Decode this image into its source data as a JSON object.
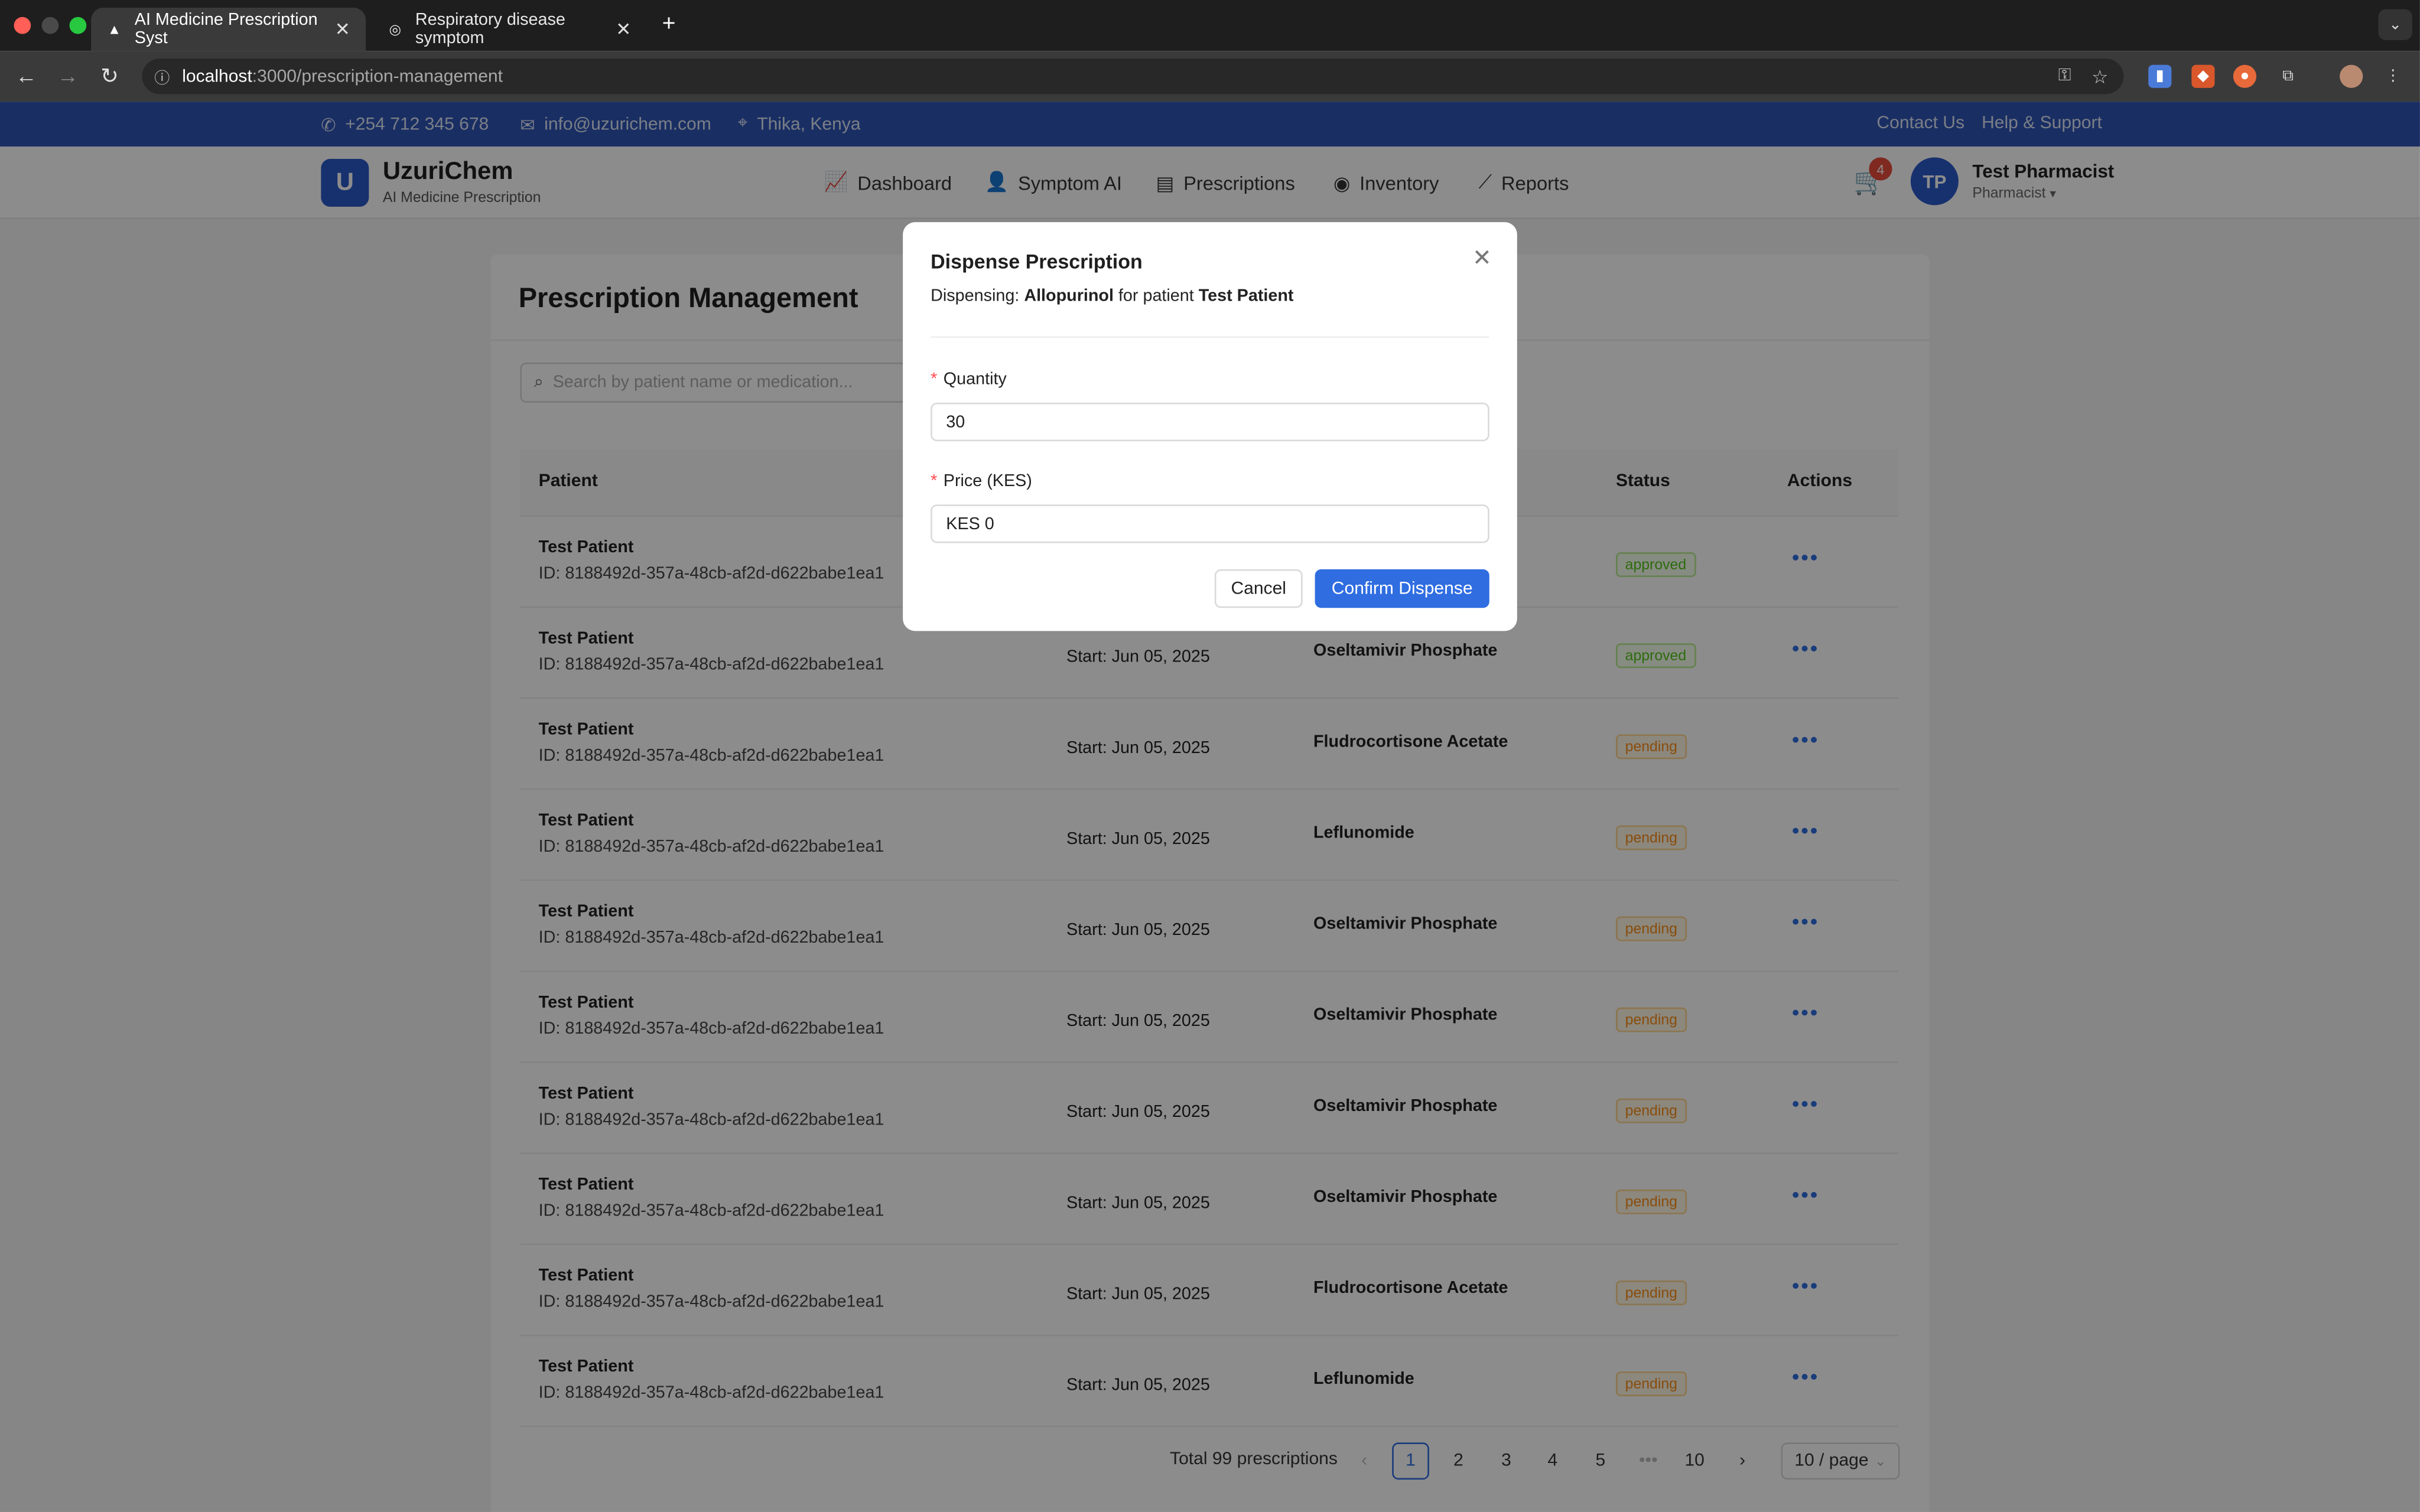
{
  "browser": {
    "tabs": [
      {
        "title": "AI Medicine Prescription Syst",
        "active": true
      },
      {
        "title": "Respiratory disease symptom",
        "active": false
      }
    ],
    "url_host": "localhost",
    "url_path": ":3000/prescription-management"
  },
  "topbar": {
    "phone": "+254 712 345 678",
    "email": "info@uzurichem.com",
    "location": "Thika, Kenya",
    "contact": "Contact Us",
    "help": "Help & Support"
  },
  "header": {
    "logo_letter": "U",
    "brand": "UzuriChem",
    "brand_sub": "AI Medicine Prescription",
    "nav": [
      "Dashboard",
      "Symptom AI",
      "Prescriptions",
      "Inventory",
      "Reports"
    ],
    "cart_count": "4",
    "avatar_initials": "TP",
    "user_name": "Test Pharmacist",
    "user_role": "Pharmacist"
  },
  "page": {
    "title": "Prescription Management",
    "search_placeholder": "Search by patient name or medication...",
    "columns": {
      "patient": "Patient",
      "status": "Status",
      "actions": "Actions"
    },
    "rows": [
      {
        "name": "Test Patient",
        "id": "ID: 8188492d-357a-48cb-af2d-d622babe1ea1",
        "date": "",
        "med": "",
        "status": "approved"
      },
      {
        "name": "Test Patient",
        "id": "ID: 8188492d-357a-48cb-af2d-d622babe1ea1",
        "date": "Start: Jun 05, 2025",
        "med": "Oseltamivir Phosphate",
        "status": "approved"
      },
      {
        "name": "Test Patient",
        "id": "ID: 8188492d-357a-48cb-af2d-d622babe1ea1",
        "date": "Start: Jun 05, 2025",
        "med": "Fludrocortisone Acetate",
        "status": "pending"
      },
      {
        "name": "Test Patient",
        "id": "ID: 8188492d-357a-48cb-af2d-d622babe1ea1",
        "date": "Start: Jun 05, 2025",
        "med": "Leflunomide",
        "status": "pending"
      },
      {
        "name": "Test Patient",
        "id": "ID: 8188492d-357a-48cb-af2d-d622babe1ea1",
        "date": "Start: Jun 05, 2025",
        "med": "Oseltamivir Phosphate",
        "status": "pending"
      },
      {
        "name": "Test Patient",
        "id": "ID: 8188492d-357a-48cb-af2d-d622babe1ea1",
        "date": "Start: Jun 05, 2025",
        "med": "Oseltamivir Phosphate",
        "status": "pending"
      },
      {
        "name": "Test Patient",
        "id": "ID: 8188492d-357a-48cb-af2d-d622babe1ea1",
        "date": "Start: Jun 05, 2025",
        "med": "Oseltamivir Phosphate",
        "status": "pending"
      },
      {
        "name": "Test Patient",
        "id": "ID: 8188492d-357a-48cb-af2d-d622babe1ea1",
        "date": "Start: Jun 05, 2025",
        "med": "Oseltamivir Phosphate",
        "status": "pending"
      },
      {
        "name": "Test Patient",
        "id": "ID: 8188492d-357a-48cb-af2d-d622babe1ea1",
        "date": "Start: Jun 05, 2025",
        "med": "Fludrocortisone Acetate",
        "status": "pending"
      },
      {
        "name": "Test Patient",
        "id": "ID: 8188492d-357a-48cb-af2d-d622babe1ea1",
        "date": "Start: Jun 05, 2025",
        "med": "Leflunomide",
        "status": "pending"
      }
    ],
    "pagination": {
      "total": "Total 99 prescriptions",
      "pages": [
        "1",
        "2",
        "3",
        "4",
        "5",
        "10"
      ],
      "current": "1",
      "page_size": "10 / page"
    }
  },
  "modal": {
    "title": "Dispense Prescription",
    "desc_prefix": "Dispensing:",
    "medication": "Allopurinol",
    "desc_mid": "for patient",
    "patient": "Test Patient",
    "quantity_label": "Quantity",
    "quantity_value": "30",
    "price_label": "Price (KES)",
    "price_value": "KES 0",
    "cancel": "Cancel",
    "confirm": "Confirm Dispense"
  },
  "colors": {
    "primary": "#2f6de1",
    "brand_blue": "#2a59c9",
    "approved": "#52c41a",
    "pending": "#fa8c16"
  }
}
